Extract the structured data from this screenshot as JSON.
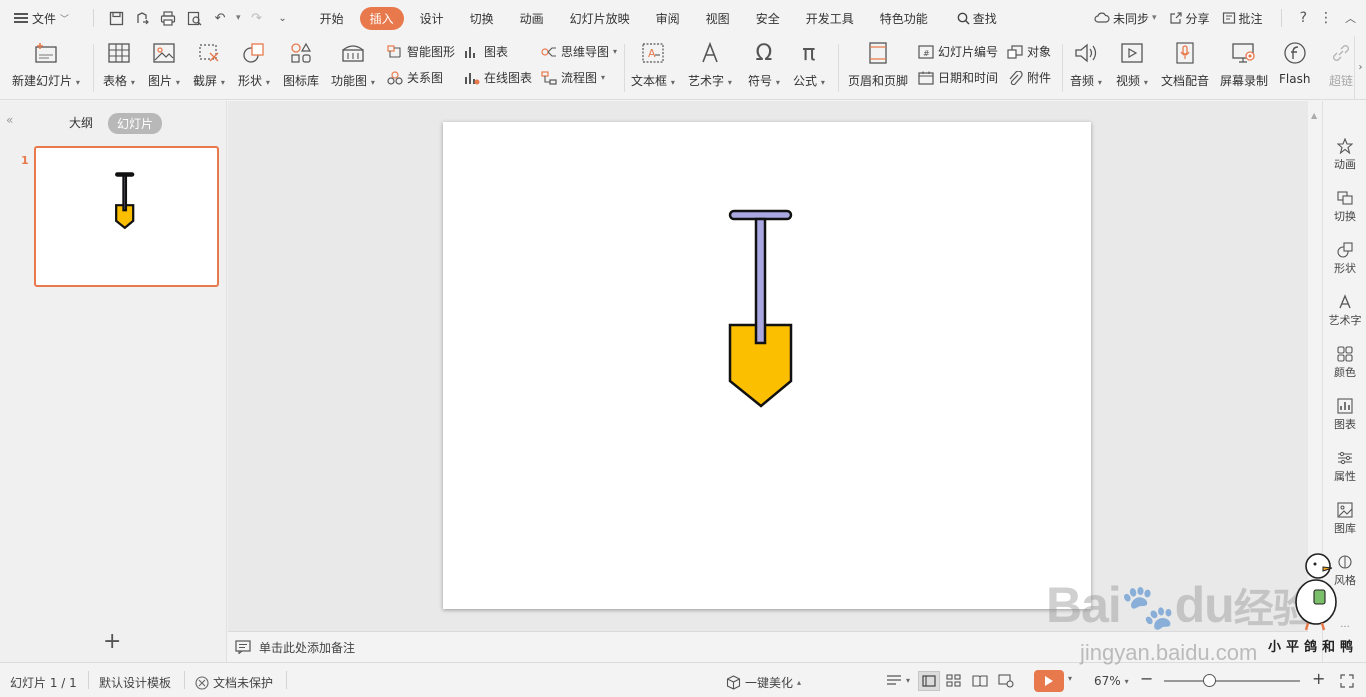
{
  "menu": {
    "file_label": "文件",
    "tabs": [
      "开始",
      "插入",
      "设计",
      "切换",
      "动画",
      "幻灯片放映",
      "审阅",
      "视图",
      "安全",
      "开发工具",
      "特色功能"
    ],
    "active_tab": "插入",
    "search_label": "查找",
    "sync_label": "未同步",
    "share_label": "分享",
    "comment_label": "批注",
    "help_icon": "?"
  },
  "ribbon": {
    "new_slide": "新建幻灯片",
    "table": "表格",
    "picture": "图片",
    "screenshot": "截屏",
    "shape": "形状",
    "icon_lib": "图标库",
    "func_chart": "功能图",
    "smart_art": "智能图形",
    "chart": "图表",
    "relation": "关系图",
    "online_chart": "在线图表",
    "mind_map": "思维导图",
    "flow_chart": "流程图",
    "textbox": "文本框",
    "art_text": "艺术字",
    "symbol": "符号",
    "formula": "公式",
    "header_footer": "页眉和页脚",
    "slide_number": "幻灯片编号",
    "object": "对象",
    "date_time": "日期和时间",
    "attachment": "附件",
    "audio": "音频",
    "video": "视频",
    "doc_voice": "文档配音",
    "screen_rec": "屏幕录制",
    "flash": "Flash",
    "hyperlink": "超链"
  },
  "left_panel": {
    "outline_tab": "大纲",
    "slides_tab": "幻灯片",
    "slide_number": "1"
  },
  "notes": {
    "placeholder": "单击此处添加备注"
  },
  "right_bar": [
    "动画",
    "切换",
    "形状",
    "艺术字",
    "颜色",
    "图表",
    "属性",
    "图库",
    "风格"
  ],
  "status": {
    "slide_counter": "幻灯片 1 / 1",
    "template": "默认设计模板",
    "protect": "文档未保护",
    "beautify": "一键美化",
    "zoom": "67%",
    "zoom_fraction": 0.33
  },
  "shape": {
    "handle_color": "#aaa8e0",
    "blade_color": "#fbbf00",
    "outline_color": "#111111"
  },
  "colors": {
    "accent": "#e8794c"
  },
  "watermark": {
    "brand": "Bai",
    "brand2": "du",
    "brand3": "经验",
    "url": "jingyan.baidu.com",
    "signature": "小平鸽和鸭"
  }
}
